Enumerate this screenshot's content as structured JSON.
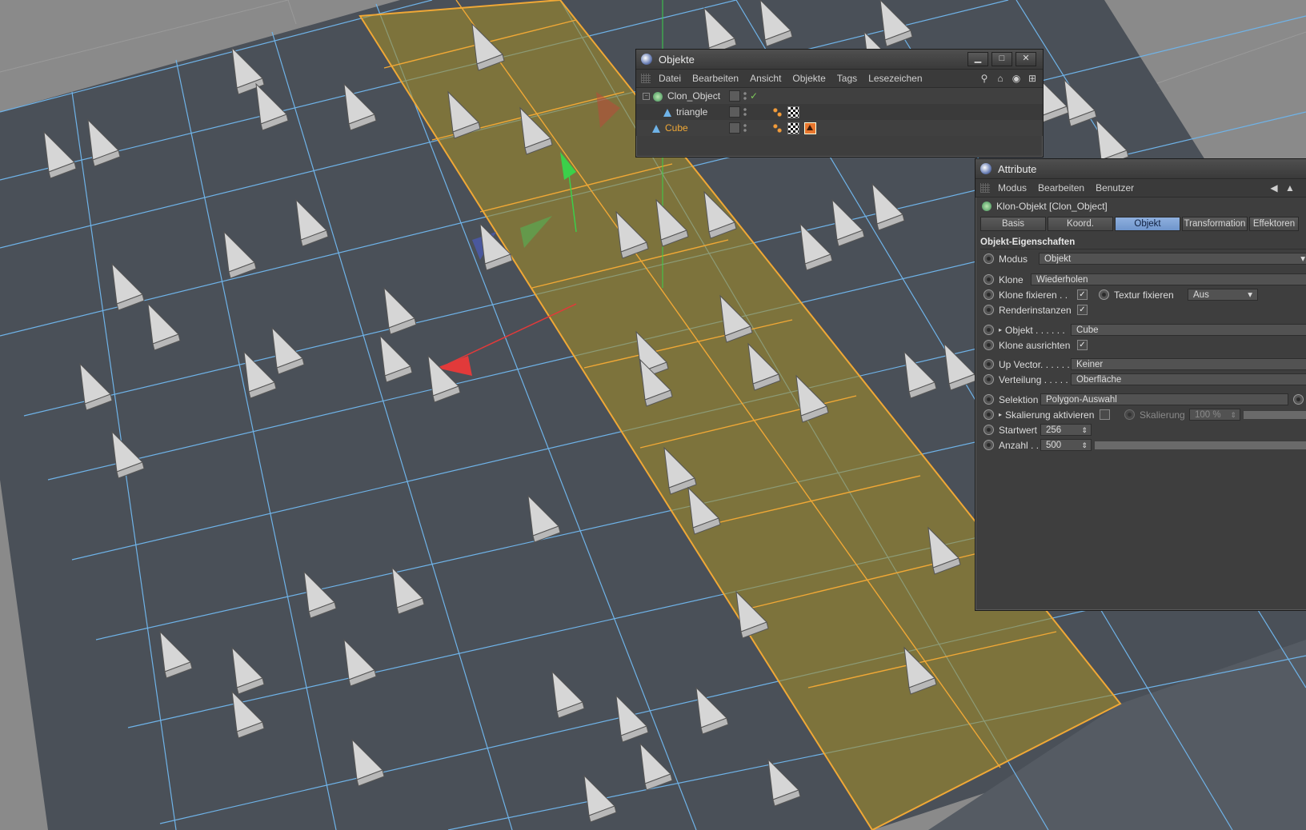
{
  "objekte_panel": {
    "title": "Objekte",
    "menu": [
      "Datei",
      "Bearbeiten",
      "Ansicht",
      "Objekte",
      "Tags",
      "Lesezeichen"
    ],
    "objects": [
      {
        "name": "Clon_Object",
        "icon": "cloner-icon",
        "check": "✓"
      },
      {
        "name": "triangle",
        "icon": "triangle-object-icon"
      },
      {
        "name": "Cube",
        "icon": "cube-object-icon"
      }
    ]
  },
  "attribute_panel": {
    "title": "Attribute",
    "menu": [
      "Modus",
      "Bearbeiten",
      "Benutzer"
    ],
    "object_header": "Klon-Objekt [Clon_Object]",
    "tabs": [
      "Basis",
      "Koord.",
      "Objekt",
      "Transformation",
      "Effektoren"
    ],
    "active_tab": "Objekt",
    "section_title": "Objekt-Eigenschaften",
    "modus": {
      "label": "Modus",
      "value": "Objekt"
    },
    "klone": {
      "label": "Klone",
      "value": "Wiederholen"
    },
    "klone_fixieren": {
      "label": "Klone fixieren . .",
      "checked": "✓"
    },
    "textur_fixieren": {
      "label": "Textur fixieren",
      "value": "Aus"
    },
    "renderinstanzen": {
      "label": "Renderinstanzen",
      "checked": "✓"
    },
    "objekt": {
      "label": "Objekt . . . . . .",
      "value": "Cube"
    },
    "klone_ausrichten": {
      "label": "Klone ausrichten",
      "checked": "✓"
    },
    "up_vector": {
      "label": "Up Vector. . . . . .",
      "value": "Keiner"
    },
    "verteilung": {
      "label": "Verteilung . . . . .",
      "value": "Oberfläche"
    },
    "selektion": {
      "label": "Selektion",
      "value": "Polygon-Auswahl"
    },
    "skalierung_aktivieren": {
      "label": "Skalierung aktivieren"
    },
    "skalierung": {
      "label": "Skalierung",
      "value": "100 %"
    },
    "startwert": {
      "label": "Startwert",
      "value": "256"
    },
    "anzahl": {
      "label": "Anzahl . .",
      "value": "500"
    }
  },
  "colors": {
    "selection": "#f0a836",
    "active_tab": "#7fa4d6",
    "grid_lines": "#6fb3e8",
    "surface": "#4a5058"
  }
}
